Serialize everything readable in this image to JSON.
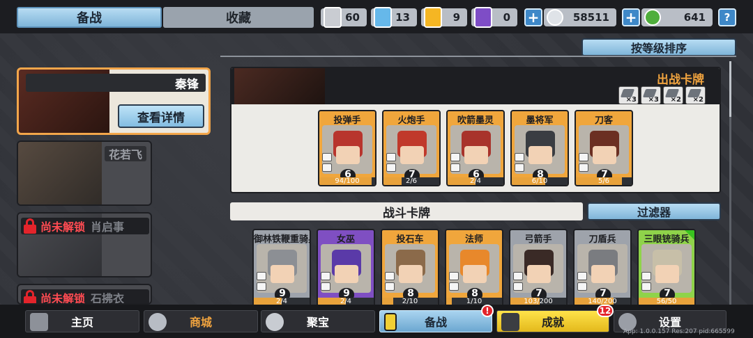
{
  "top_tabs": {
    "active": "备战",
    "inactive": "收藏"
  },
  "resources": [
    {
      "icon": "silver-shield-icon",
      "value": "60",
      "color": "#c9ccd2"
    },
    {
      "icon": "blue-crystal-icon",
      "value": "13",
      "color": "#66b8ea"
    },
    {
      "icon": "gold-badge-icon",
      "value": "9",
      "color": "#f5b623"
    },
    {
      "icon": "purple-gem-icon",
      "value": "0",
      "color": "#7e4dc6"
    }
  ],
  "currency": [
    {
      "icon": "silver-coin-icon",
      "value": "58511"
    },
    {
      "icon": "green-gem-icon",
      "value": "641"
    }
  ],
  "help_label": "?",
  "sort_label": "按等级排序",
  "heroes": {
    "selected": {
      "name": "秦锋",
      "detail_label": "查看详情"
    },
    "second": {
      "name": "花若飞"
    },
    "locked": [
      {
        "status": "尚未解锁",
        "name": "肖启事"
      },
      {
        "status": "尚未解锁",
        "name": "石拂衣"
      }
    ]
  },
  "deck": {
    "title": "出战卡牌",
    "bonuses": [
      "×3",
      "×3",
      "×2",
      "×2"
    ],
    "cards": [
      {
        "name": "投弹手",
        "level": "6",
        "count": "94/100",
        "progress": 0.94,
        "head": "#b8352d"
      },
      {
        "name": "火炮手",
        "level": "7",
        "count": "2/6",
        "progress": 0.33,
        "head": "#c0392b"
      },
      {
        "name": "吹箭墨灵",
        "level": "6",
        "count": "2/4",
        "progress": 0.5,
        "head": "#a8332b"
      },
      {
        "name": "墨将军",
        "level": "8",
        "count": "6/10",
        "progress": 0.6,
        "head": "#3a3d42"
      },
      {
        "name": "刀客",
        "level": "7",
        "count": "5/6",
        "progress": 0.83,
        "head": "#6b2f22"
      }
    ]
  },
  "battle": {
    "title": "战斗卡牌",
    "filter_label": "过滤器",
    "cards": [
      {
        "name": "御林铁鞭重骑兵",
        "level": "9",
        "count": "2/4",
        "progress": 0.5,
        "rarity": "gray",
        "head": "#8c8f94"
      },
      {
        "name": "女巫",
        "level": "9",
        "count": "2/4",
        "progress": 0.5,
        "rarity": "purple",
        "head": "#5a3aa8"
      },
      {
        "name": "投石车",
        "level": "8",
        "count": "2/10",
        "progress": 0.2,
        "rarity": "gold",
        "head": "#8b6a4a"
      },
      {
        "name": "法师",
        "level": "8",
        "count": "1/10",
        "progress": 0.1,
        "rarity": "gold",
        "head": "#e8882b"
      },
      {
        "name": "弓箭手",
        "level": "7",
        "count": "103/200",
        "progress": 0.52,
        "rarity": "gray",
        "head": "#3a2a26"
      },
      {
        "name": "刀盾兵",
        "level": "7",
        "count": "140/200",
        "progress": 0.7,
        "rarity": "gray",
        "head": "#7a7c80"
      },
      {
        "name": "三眼铳骑兵",
        "level": "7",
        "count": "56/50",
        "progress": 1,
        "rarity": "green",
        "head": "#c7bfa8"
      }
    ]
  },
  "nav": [
    {
      "label": "主页",
      "icon": "home-icon"
    },
    {
      "label": "商城",
      "icon": "shop-coins-icon"
    },
    {
      "label": "聚宝",
      "icon": "treasure-bowl-icon"
    },
    {
      "label": "备战",
      "icon": "card-deck-icon",
      "badge": "!"
    },
    {
      "label": "成就",
      "icon": "achievement-grid-icon",
      "badge": "12"
    },
    {
      "label": "设置",
      "icon": "gear-icon"
    }
  ],
  "version": "App: 1.0.0.157 Res:207 pid:665599"
}
